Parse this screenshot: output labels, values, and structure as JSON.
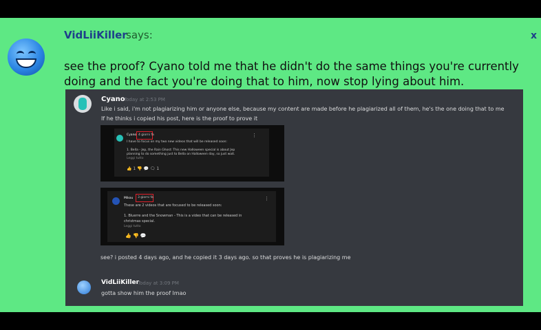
{
  "header": {
    "username": "VidLiiKiller",
    "says": "says:",
    "close": "x"
  },
  "comment_text": "see the proof? Cyano told me that he didn't do the same things you're currently doing and the fact you're doing that to him, now stop lying about him.",
  "screenshot": {
    "msg1": {
      "author": "Cyano",
      "time": "Today at 2:53 PM",
      "line1": "Like i said, i'm not plagiarizing him or anyone else, because my content are made before he plagiarized all of them, he's the one doing that to me",
      "line2": "If he thinks i copied his post, here is the proof to prove it",
      "line3": "see? i posted 4 days ago, and he copied it 3 days ago. so that proves he is plagiarizing me"
    },
    "card1": {
      "header": "Cyano",
      "header_tag": "4 giorni fa",
      "line1": "I have to focus on my two new videos that will be released soon:",
      "line2": "1. Bella - Jep, the Rain Ghost: This new Halloween special is about Jep",
      "line3": "planning to do something just to Bella on Halloween day, so just wait.",
      "more": "Leggi tutto",
      "controls": "👍 1  👎   💬   🗨 1"
    },
    "card2": {
      "header": "Mikou",
      "header_tag": "3 giorni fa",
      "line1": "These are 2 videos that are focused to be released soon:",
      "line2": "1. Bluerre and the Snowman - This is a video that can be released in",
      "line3": "christmas special.",
      "more": "Leggi tutto",
      "controls": "👍 👎    💬"
    },
    "msg2": {
      "author": "VidLiiKiller",
      "time": "Today at 3:09 PM",
      "line1": "gotta show him the proof lmao"
    }
  },
  "colors": {
    "panel_bg": "#5ee884",
    "username": "#1e3f8a",
    "screenshot_bg": "#36393f",
    "highlight": "#e0212b"
  }
}
